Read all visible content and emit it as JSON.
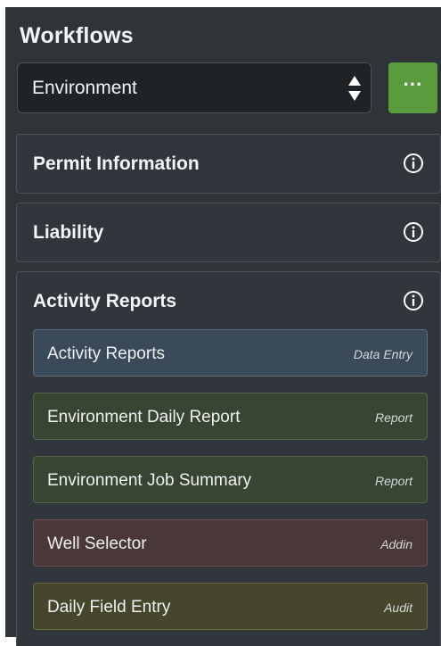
{
  "workflows": {
    "title": "Workflows",
    "selector": {
      "value": "Environment",
      "arrows_icon": "sort-arrows-icon"
    },
    "more_button": {
      "label": "···",
      "color": "#5a9b3d"
    },
    "sections": [
      {
        "title": "Permit Information",
        "icon": "info-icon"
      },
      {
        "title": "Liability",
        "icon": "info-icon"
      },
      {
        "title": "Activity Reports",
        "icon": "info-icon",
        "items": [
          {
            "label": "Activity Reports",
            "tag": "Data Entry",
            "color": "#3a4a58"
          },
          {
            "label": "Environment Daily Report",
            "tag": "Report",
            "color": "#384532"
          },
          {
            "label": "Environment Job Summary",
            "tag": "Report",
            "color": "#384532"
          },
          {
            "label": "Well Selector",
            "tag": "Addin",
            "color": "#4a3838"
          },
          {
            "label": "Daily Field Entry",
            "tag": "Audit",
            "color": "#46462d"
          }
        ]
      }
    ]
  }
}
